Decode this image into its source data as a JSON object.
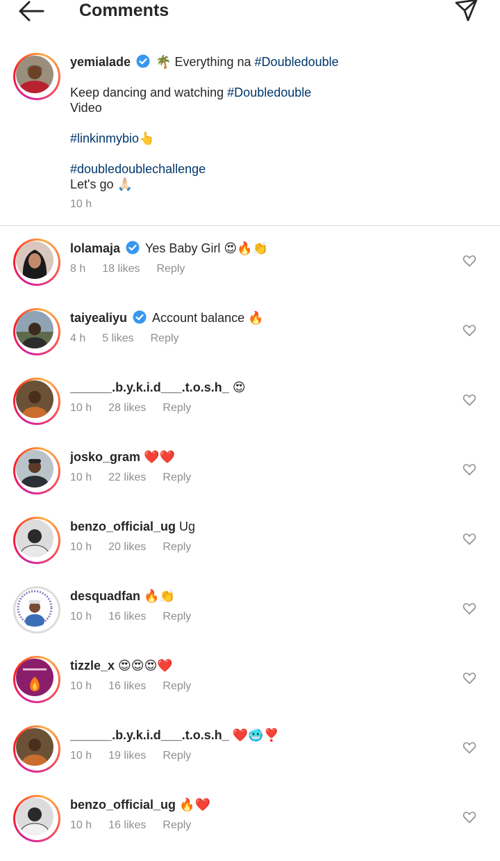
{
  "header": {
    "title": "Comments"
  },
  "caption": {
    "username": "yemialade",
    "line1_text": "🌴 Everything na ",
    "line1_tag": "#Doubledouble",
    "line2_text": "Keep dancing and watching ",
    "line2_tag": "#Doubledouble",
    "line3_text": "Video",
    "line4_tag": "#linkinmybio",
    "line4_emoji": "👆",
    "line5_tag": "#doubledoublechallenge",
    "line6_text": "Let's go 🙏🏻",
    "time": "10 h"
  },
  "reply_label": "Reply",
  "comments": [
    {
      "username": "lolamaja",
      "verified": true,
      "text": "Yes Baby Girl 😍🔥👏",
      "time": "8 h",
      "likes": "18 likes"
    },
    {
      "username": "taiyealiyu",
      "verified": true,
      "text": "Account balance 🔥",
      "time": "4 h",
      "likes": "5 likes"
    },
    {
      "username": "______.b.y.k.i.d___.t.o.s.h_",
      "verified": false,
      "text": "😍",
      "time": "10 h",
      "likes": "28 likes"
    },
    {
      "username": "josko_gram",
      "verified": false,
      "text": "❤️❤️",
      "time": "10 h",
      "likes": "22 likes"
    },
    {
      "username": "benzo_official_ug",
      "verified": false,
      "text": "Ug",
      "time": "10 h",
      "likes": "20 likes"
    },
    {
      "username": "desquadfan",
      "verified": false,
      "text": "🔥👏",
      "time": "10 h",
      "likes": "16 likes"
    },
    {
      "username": "tizzle_x",
      "verified": false,
      "text": "😍😍😍❤️",
      "time": "10 h",
      "likes": "16 likes"
    },
    {
      "username": "______.b.y.k.i.d___.t.o.s.h_",
      "verified": false,
      "text": "❤️🥶❣️",
      "time": "10 h",
      "likes": "19 likes"
    },
    {
      "username": "benzo_official_ug",
      "verified": false,
      "text": "🔥❤️",
      "time": "10 h",
      "likes": "16 likes"
    }
  ]
}
